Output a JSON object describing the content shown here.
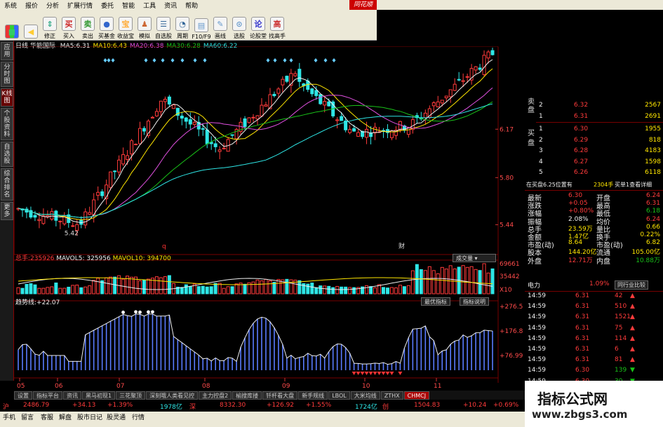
{
  "menu": {
    "items": [
      "系统",
      "报价",
      "分析",
      "扩展行情",
      "委托",
      "智能",
      "工具",
      "资讯",
      "帮助"
    ],
    "brand": "同花顺"
  },
  "toolbar": {
    "buttons": [
      {
        "label": "",
        "icon": "color-grid-icon"
      },
      {
        "label": "",
        "icon": "back-arrow-icon"
      },
      {
        "label": "修正",
        "icon": "up-down-icon"
      },
      {
        "label": "买入",
        "icon": "buy-icon",
        "glyph": "买"
      },
      {
        "label": "卖出",
        "icon": "sell-icon",
        "glyph": "卖"
      },
      {
        "label": "买基金",
        "icon": "fund-icon"
      },
      {
        "label": "收益宝",
        "icon": "treasure-icon",
        "glyph": "宝"
      },
      {
        "label": "模拟",
        "icon": "simulate-icon"
      },
      {
        "label": "自选股",
        "icon": "favorites-icon"
      },
      {
        "label": "周期",
        "icon": "period-icon"
      },
      {
        "label": "F10/F9",
        "icon": "f10-icon"
      },
      {
        "label": "画线",
        "icon": "draw-line-icon"
      },
      {
        "label": "选股",
        "icon": "stock-picker-icon"
      },
      {
        "label": "论股堂",
        "icon": "forum-icon",
        "glyph": "论"
      },
      {
        "label": "找高手",
        "icon": "expert-icon",
        "glyph": "高"
      }
    ]
  },
  "sidebar": {
    "tabs": [
      "应用",
      "分时图",
      "K线图",
      "个股资料",
      "自选股",
      "综合排名",
      "更多"
    ],
    "active": 2
  },
  "chart": {
    "period": "日线",
    "name": "华能国际",
    "ma": [
      {
        "label": "MA5:",
        "value": "6.31",
        "color": "#f0f0f0"
      },
      {
        "label": "MA10:",
        "value": "6.43",
        "color": "#ffe600"
      },
      {
        "label": "MA20:",
        "value": "6.38",
        "color": "#e050e0"
      },
      {
        "label": "MA30:",
        "value": "6.28",
        "color": "#19c319"
      },
      {
        "label": "MA60:",
        "value": "6.22",
        "color": "#2ee6e6"
      }
    ],
    "price_ticks": [
      "6.17",
      "5.80",
      "5.44"
    ],
    "low_label": "5.42",
    "markers": [
      "q",
      "财"
    ]
  },
  "volume": {
    "label": "总手:",
    "value": "235926",
    "mavol5": "MAVOL5: 325956",
    "mavol10": "MAVOL10: 394700",
    "button": "成交量",
    "ticks": [
      "69661",
      "35442",
      "X10"
    ]
  },
  "oscillator": {
    "label": "趋势线:",
    "value": "+22.07",
    "buttons": [
      "最优指标",
      "指标说明"
    ],
    "ticks": [
      "+276.5",
      "+176.8",
      "+76.99"
    ]
  },
  "x_ticks": [
    "05",
    "06",
    "07",
    "08",
    "09",
    "10",
    "11"
  ],
  "order_book": {
    "sell_label": "卖盘",
    "buy_label": "买盘",
    "asks": [
      {
        "lvl": "2",
        "price": "6.32",
        "vol": "2567"
      },
      {
        "lvl": "1",
        "price": "6.31",
        "vol": "2691"
      }
    ],
    "bids": [
      {
        "lvl": "1",
        "price": "6.30",
        "vol": "1955"
      },
      {
        "lvl": "2",
        "price": "6.29",
        "vol": "818"
      },
      {
        "lvl": "3",
        "price": "6.28",
        "vol": "4183"
      },
      {
        "lvl": "4",
        "price": "6.27",
        "vol": "1598"
      },
      {
        "lvl": "5",
        "price": "6.26",
        "vol": "6118"
      }
    ],
    "queue_text": "在买盘6.25位置有",
    "queue_vol": "2304手",
    "queue_link": "买单1查看详细"
  },
  "stats": [
    {
      "k1": "最新",
      "v1": "6.30",
      "c1": "red",
      "k2": "开盘",
      "v2": "6.24",
      "c2": "red"
    },
    {
      "k1": "涨跌",
      "v1": "+0.05",
      "c1": "red",
      "k2": "最高",
      "v2": "6.31",
      "c2": "red"
    },
    {
      "k1": "涨幅",
      "v1": "+0.80%",
      "c1": "red",
      "k2": "最低",
      "v2": "6.18",
      "c2": "grn"
    },
    {
      "k1": "振幅",
      "v1": "2.08%",
      "c1": "wht",
      "k2": "均价",
      "v2": "6.24",
      "c2": "red"
    },
    {
      "k1": "总手",
      "v1": "23.59万",
      "c1": "yel",
      "k2": "量比",
      "v2": "0.66",
      "c2": "yel"
    },
    {
      "k1": "金额",
      "v1": "1.47亿",
      "c1": "yel",
      "k2": "换手",
      "v2": "0.22%",
      "c2": "yel"
    },
    {
      "k1": "市盈(动)",
      "v1": "8.64",
      "c1": "yel",
      "k2": "市盈(动)",
      "v2": "6.82",
      "c2": "yel"
    },
    {
      "k1": "股本",
      "v1": "144.20亿",
      "c1": "yel",
      "k2": "流通",
      "v2": "105.00亿",
      "c2": "yel"
    },
    {
      "k1": "外盘",
      "v1": "12.71万",
      "c1": "red",
      "k2": "内盘",
      "v2": "10.88万",
      "c2": "grn"
    }
  ],
  "industry": {
    "name": "电力",
    "pct": "1.09%",
    "button": "同行业比较"
  },
  "ticks": [
    {
      "t": "14:59",
      "p": "6.31",
      "v": "42",
      "d": "up"
    },
    {
      "t": "14:59",
      "p": "6.31",
      "v": "510",
      "d": "up"
    },
    {
      "t": "14:59",
      "p": "6.31",
      "v": "1521",
      "d": "up"
    },
    {
      "t": "14:59",
      "p": "6.31",
      "v": "75",
      "d": "up"
    },
    {
      "t": "14:59",
      "p": "6.31",
      "v": "114",
      "d": "up"
    },
    {
      "t": "14:59",
      "p": "6.31",
      "v": "6",
      "d": "up"
    },
    {
      "t": "14:59",
      "p": "6.31",
      "v": "81",
      "d": "up"
    },
    {
      "t": "14:59",
      "p": "6.30",
      "v": "139",
      "d": "down"
    },
    {
      "t": "14:59",
      "p": "6.30",
      "v": "30",
      "d": "down"
    }
  ],
  "tabs": [
    "设置",
    "指标平台",
    "资讯",
    "黑马初现1",
    "三花聚顶",
    "深刻哦人类看见控",
    "主力控盘2",
    "榆搜库搂",
    "钎杆看大盘",
    "新手规线",
    "LBOL",
    "大米均线",
    "ZTHX",
    "CHMCJ"
  ],
  "tabs_active": 13,
  "index_bar": {
    "sh": "沪",
    "sh_val": "2486.79",
    "sh_chg": "+34.13",
    "sh_pct": "+1.39%",
    "sh_amt": "1978亿",
    "sz": "深",
    "sz_val": "8332.30",
    "sz_chg": "+126.92",
    "sz_pct": "+1.55%",
    "sz_amt": "1724亿",
    "cy": "创",
    "cy_val": "1504.83",
    "cy_chg": "+10.24",
    "cy_pct": "+0.69%"
  },
  "bottom_menu": [
    "手机",
    "留言",
    "客服",
    "解盘",
    "股市日记",
    "股灵通",
    "行情"
  ],
  "watermark": {
    "title": "指标公式网",
    "url": "www.zbgs3.com"
  },
  "colors": {
    "up": "#ff3b3b",
    "down": "#2ee6e6",
    "ma5": "#f0f0f0",
    "ma10": "#ffe600",
    "ma20": "#e050e0",
    "ma30": "#19c319",
    "ma60": "#2ee6e6"
  }
}
